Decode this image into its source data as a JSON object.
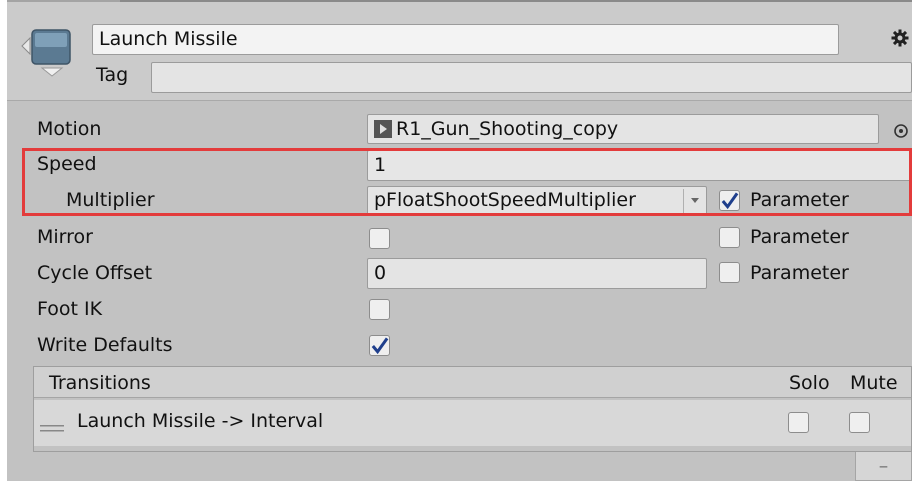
{
  "header": {
    "name_value": "Launch Missile",
    "tag_label": "Tag",
    "tag_value": ""
  },
  "properties": {
    "motion_label": "Motion",
    "motion_value": "R1_Gun_Shooting_copy",
    "speed_label": "Speed",
    "speed_value": "1",
    "multiplier_label": "Multiplier",
    "multiplier_value": "pFloatShootSpeedMultiplier",
    "multiplier_param_label": "Parameter",
    "multiplier_param_checked": true,
    "mirror_label": "Mirror",
    "mirror_checked": false,
    "mirror_param_label": "Parameter",
    "mirror_param_checked": false,
    "cycle_offset_label": "Cycle Offset",
    "cycle_offset_value": "0",
    "cycle_param_label": "Parameter",
    "cycle_param_checked": false,
    "foot_ik_label": "Foot IK",
    "foot_ik_checked": false,
    "write_defaults_label": "Write Defaults",
    "write_defaults_checked": true
  },
  "transitions": {
    "header_label": "Transitions",
    "solo_label": "Solo",
    "mute_label": "Mute",
    "items": [
      {
        "label": "Launch Missile -> Interval",
        "solo": false,
        "mute": false
      }
    ]
  },
  "footer": {
    "remove_label": "–"
  },
  "colors": {
    "highlight": "#e33b3b",
    "checkmark": "#1f3f8c"
  },
  "icons": {
    "state_icon": "animator-state-icon",
    "settings_icon": "gear-icon",
    "motion_icon": "animation-clip-icon",
    "picker_icon": "object-picker-icon",
    "dropdown_icon": "dropdown-arrow-icon",
    "drag_handle_icon": "drag-handle-icon"
  }
}
